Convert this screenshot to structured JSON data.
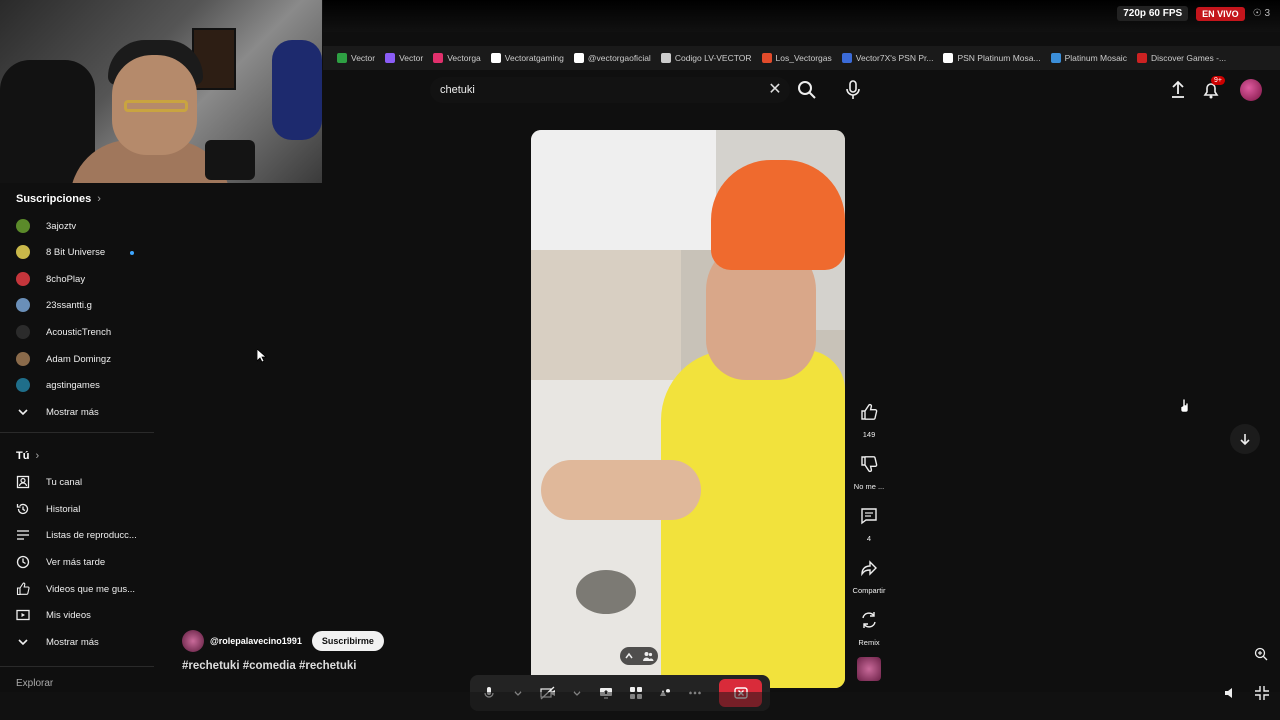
{
  "stream": {
    "quality": "720p 60 FPS",
    "live_label": "EN VIVO",
    "viewers": "3"
  },
  "bookmarks": [
    {
      "label": "Vector",
      "color": "#2ea043"
    },
    {
      "label": "Vector",
      "color": "#8a5cf6"
    },
    {
      "label": "Vectorga",
      "color": "#e1306c"
    },
    {
      "label": "Vectoratgaming",
      "color": "#ffffff"
    },
    {
      "label": "@vectorgaoficial",
      "color": "#ffffff"
    },
    {
      "label": "Codigo LV-VECTOR",
      "color": "#cccccc"
    },
    {
      "label": "Los_Vectorgas",
      "color": "#e24b2b"
    },
    {
      "label": "Vector7X's PSN Pr...",
      "color": "#3b6bd8"
    },
    {
      "label": "PSN Platinum Mosa...",
      "color": "#ffffff"
    },
    {
      "label": "Platinum Mosaic",
      "color": "#3b8ed8"
    },
    {
      "label": "Discover Games -...",
      "color": "#cc2222"
    }
  ],
  "search": {
    "value": "chetuki"
  },
  "notifications": {
    "badge": "9+"
  },
  "subscriptions": {
    "title": "Suscripciones",
    "items": [
      {
        "label": "3ajoztv",
        "color": "#5b8a2a"
      },
      {
        "label": "8 Bit Universe",
        "color": "#c9b84a"
      },
      {
        "label": "8choPlay",
        "color": "#c4353b"
      },
      {
        "label": "23ssantti.g",
        "color": "#6a8fb8"
      },
      {
        "label": "AcousticTrench",
        "color": "#2b2b2b"
      },
      {
        "label": "Adam Domingz",
        "color": "#8a6a4a"
      },
      {
        "label": "agstingames",
        "color": "#1f6e8a"
      }
    ],
    "show_more": "Mostrar más"
  },
  "you": {
    "title": "Tú",
    "items": [
      {
        "label": "Tu canal"
      },
      {
        "label": "Historial"
      },
      {
        "label": "Listas de reproducc..."
      },
      {
        "label": "Ver más tarde"
      },
      {
        "label": "Videos que me gus..."
      },
      {
        "label": "Mis videos"
      }
    ],
    "show_more": "Mostrar más"
  },
  "explore": "Explorar",
  "short": {
    "channel": "@rolepalavecino1991",
    "subscribe": "Suscribirme",
    "hashtags": "#rechetuki #comedia #rechetuki",
    "likes": "149",
    "dislike_label": "No me ...",
    "comments": "4",
    "share_label": "Compartir",
    "remix_label": "Remix"
  }
}
